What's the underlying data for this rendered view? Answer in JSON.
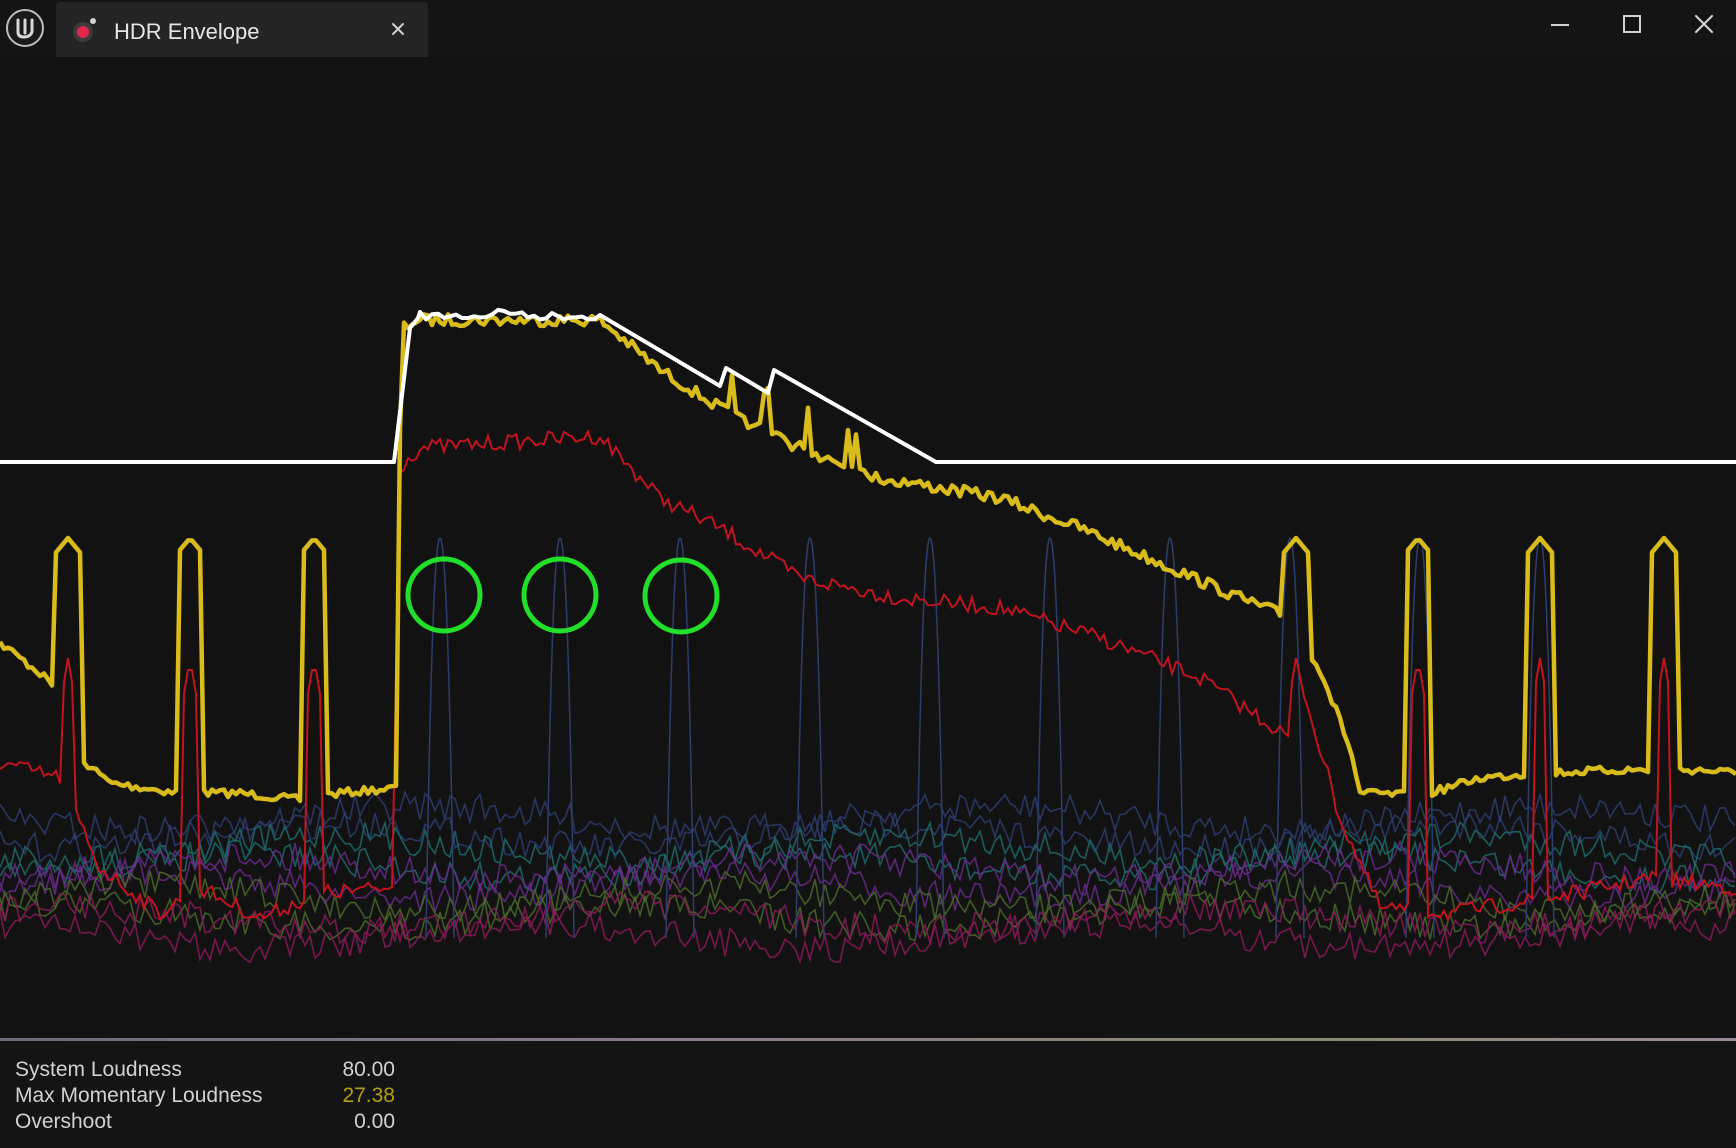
{
  "window": {
    "tab_title": "HDR Envelope",
    "accent_color": "#d9bc1b"
  },
  "icons": {
    "app_logo": "unreal-engine-logo-icon",
    "tab_icon": "audio-record-icon",
    "tab_close": "close-icon",
    "minimize": "minimize-icon",
    "maximize": "maximize-icon",
    "close": "close-icon"
  },
  "graph": {
    "background": "#121212",
    "series_colors": {
      "hdr_envelope": "#ffffff",
      "max_momentary_loudness": "#b3a012",
      "loudness": "#c0151f",
      "sources": [
        "#2d3d6e",
        "#1f6b6b",
        "#6a2a8a",
        "#4a6a2a",
        "#8a1a5a"
      ]
    },
    "markers": [
      {
        "color": "#22e02a"
      },
      {
        "color": "#22e02a"
      },
      {
        "color": "#22e02a"
      }
    ]
  },
  "stats": [
    {
      "label": "System Loudness",
      "value": "80.00",
      "value_color": "#d2d2d2"
    },
    {
      "label": "Max Momentary Loudness",
      "value": "27.38",
      "value_color": "#b3a012"
    },
    {
      "label": "Overshoot",
      "value": "0.00",
      "value_color": "#d2d2d2"
    }
  ]
}
